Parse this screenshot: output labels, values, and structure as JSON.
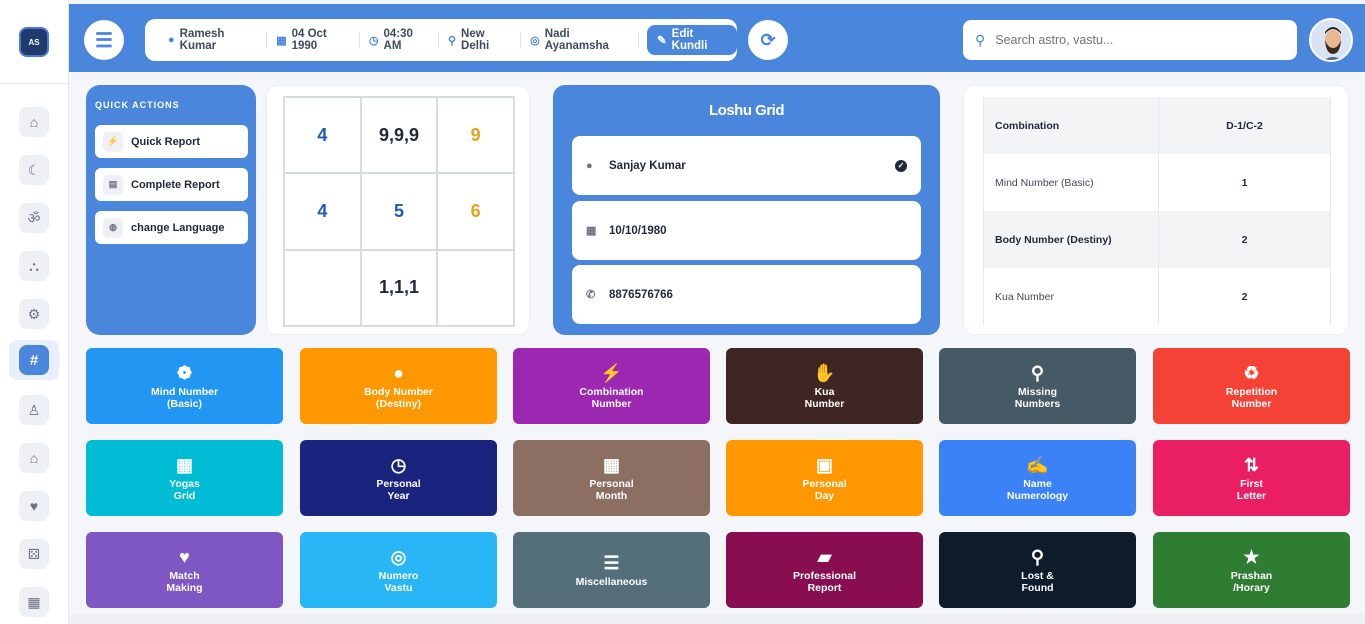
{
  "sidebar": {
    "logo_text": "AS",
    "items": [
      {
        "icon": "home-icon",
        "glyph": "⌂"
      },
      {
        "icon": "moon-star-icon",
        "glyph": "☾"
      },
      {
        "icon": "om-icon",
        "glyph": "ॐ"
      },
      {
        "icon": "sitemap-icon",
        "glyph": "⛬"
      },
      {
        "icon": "gear-icon",
        "glyph": "⚙"
      },
      {
        "icon": "hashtag-icon",
        "glyph": "#"
      },
      {
        "icon": "user-astronaut-icon",
        "glyph": "♙"
      },
      {
        "icon": "house-icon",
        "glyph": "⌂"
      },
      {
        "icon": "heart-icon",
        "glyph": "♥"
      },
      {
        "icon": "dice-icon",
        "glyph": "⚄"
      },
      {
        "icon": "calendar-icon",
        "glyph": "▦"
      }
    ]
  },
  "header": {
    "name": "Ramesh Kumar",
    "dob": "04 Oct 1990",
    "time": "04:30 AM",
    "place": "New Delhi",
    "ayanamsha": "Nadi Ayanamsha",
    "edit_label": "Edit Kundli",
    "search_placeholder": "Search astro, vastu..."
  },
  "quick_actions": {
    "title": "QUICK ACTIONS",
    "items": [
      {
        "label": "Quick Report",
        "icon": "bolt-icon",
        "glyph": "⚡"
      },
      {
        "label": "Complete Report",
        "icon": "file-icon",
        "glyph": "▤"
      },
      {
        "label": "change Language",
        "icon": "globe-icon",
        "glyph": "◍"
      }
    ]
  },
  "number_grid": {
    "cells": [
      {
        "text": "4",
        "color": "#1e5bbf"
      },
      {
        "text": "9,9,9",
        "color": "#1f2937"
      },
      {
        "text": "9",
        "color": "#e6a21a"
      },
      {
        "text": "4",
        "color": "#1e5bbf"
      },
      {
        "text": "5",
        "color": "#1e5bbf"
      },
      {
        "text": "6",
        "color": "#e6a21a"
      },
      {
        "text": "",
        "color": "#1f2937"
      },
      {
        "text": "1,1,1",
        "color": "#1f2937"
      },
      {
        "text": "",
        "color": "#1f2937"
      }
    ]
  },
  "loshu": {
    "title": "Loshu Grid",
    "name": "Sanjay Kumar",
    "dob": "10/10/1980",
    "phone": "8876576766"
  },
  "combination_table": {
    "rows": [
      {
        "label": "Combination",
        "value": "D-1/C-2"
      },
      {
        "label": "Mind Number (Basic)",
        "value": "1"
      },
      {
        "label": "Body Number (Destiny)",
        "value": "2"
      },
      {
        "label": "Kua Number",
        "value": "2"
      }
    ]
  },
  "tiles": [
    {
      "label": "Mind Number\n(Basic)",
      "icon": "brain-icon",
      "glyph": "❁",
      "color": "#2196f3"
    },
    {
      "label": "Body Number\n(Destiny)",
      "icon": "user-icon",
      "glyph": "●",
      "color": "#ff9800"
    },
    {
      "label": "Combination\nNumber",
      "icon": "bolt-icon",
      "glyph": "⚡",
      "color": "#9c27b0"
    },
    {
      "label": "Kua\nNumber",
      "icon": "handshake-icon",
      "glyph": "✋",
      "color": "#3e2723"
    },
    {
      "label": "Missing\nNumbers",
      "icon": "search-icon",
      "glyph": "⚲",
      "color": "#455a64"
    },
    {
      "label": "Repetition\nNumber",
      "icon": "recycle-icon",
      "glyph": "♻",
      "color": "#f44336"
    },
    {
      "label": "Yogas\nGrid",
      "icon": "table-icon",
      "glyph": "▦",
      "color": "#00bcd4"
    },
    {
      "label": "Personal\nYear",
      "icon": "clock-icon",
      "glyph": "◷",
      "color": "#1a237e"
    },
    {
      "label": "Personal\nMonth",
      "icon": "calendar-icon",
      "glyph": "▦",
      "color": "#8d6e63"
    },
    {
      "label": "Personal\nDay",
      "icon": "calendar-day-icon",
      "glyph": "▣",
      "color": "#ff9800"
    },
    {
      "label": "Name\nNumerology",
      "icon": "signature-icon",
      "glyph": "✍",
      "color": "#3b82f6"
    },
    {
      "label": "First\nLetter",
      "icon": "sort-alpha-icon",
      "glyph": "⇅",
      "color": "#e91e63"
    },
    {
      "label": "Match\nMaking",
      "icon": "heart-check-icon",
      "glyph": "♥",
      "color": "#7e57c2"
    },
    {
      "label": "Numero\nVastu",
      "icon": "compass-icon",
      "glyph": "◎",
      "color": "#29b6f6"
    },
    {
      "label": "Miscellaneous",
      "icon": "list-icon",
      "glyph": "☰",
      "color": "#546e7a"
    },
    {
      "label": "Professional\nReport",
      "icon": "briefcase-icon",
      "glyph": "▰",
      "color": "#880e4f"
    },
    {
      "label": "Lost &\nFound",
      "icon": "search-chart-icon",
      "glyph": "⚲",
      "color": "#0d1b2a"
    },
    {
      "label": "Prashan\n/Horary",
      "icon": "star-icon",
      "glyph": "★",
      "color": "#2e7d32"
    }
  ]
}
